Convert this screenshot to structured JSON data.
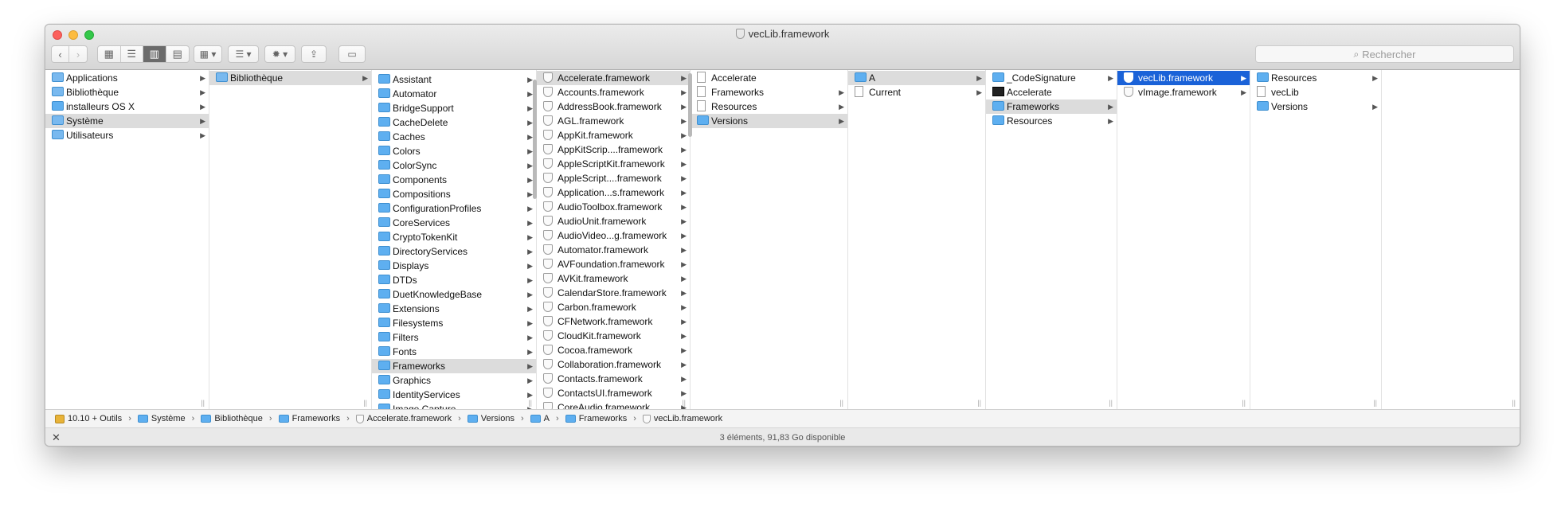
{
  "window": {
    "title": "vecLib.framework"
  },
  "toolbar": {
    "back": "‹",
    "forward": "›",
    "view_icon": "▦",
    "view_list": "☰",
    "view_column": "▥",
    "view_cover": "▤",
    "arrange": "▦ ▾",
    "sort": "☰ ▾",
    "action": "✹ ▾",
    "share": "⇪",
    "tags": "▭"
  },
  "search": {
    "placeholder": "Rechercher",
    "icon": "search-icon"
  },
  "columns": [
    {
      "items": [
        {
          "label": "Applications",
          "icon": "folder-gen",
          "arrow": true
        },
        {
          "label": "Bibliothèque",
          "icon": "folder-gen",
          "arrow": true
        },
        {
          "label": "installeurs OS X",
          "icon": "folder",
          "arrow": true
        },
        {
          "label": "Système",
          "icon": "folder-gen",
          "arrow": true,
          "state": "sel"
        },
        {
          "label": "Utilisateurs",
          "icon": "folder-gen",
          "arrow": true
        }
      ]
    },
    {
      "items": [
        {
          "label": "Bibliothèque",
          "icon": "folder-gen",
          "arrow": true,
          "state": "sel"
        }
      ]
    },
    {
      "items": [
        {
          "label": "Assistant",
          "icon": "folder",
          "arrow": true
        },
        {
          "label": "Automator",
          "icon": "folder",
          "arrow": true
        },
        {
          "label": "BridgeSupport",
          "icon": "folder",
          "arrow": true
        },
        {
          "label": "CacheDelete",
          "icon": "folder",
          "arrow": true
        },
        {
          "label": "Caches",
          "icon": "folder",
          "arrow": true
        },
        {
          "label": "Colors",
          "icon": "folder",
          "arrow": true
        },
        {
          "label": "ColorSync",
          "icon": "folder",
          "arrow": true
        },
        {
          "label": "Components",
          "icon": "folder",
          "arrow": true
        },
        {
          "label": "Compositions",
          "icon": "folder",
          "arrow": true
        },
        {
          "label": "ConfigurationProfiles",
          "icon": "folder",
          "arrow": true
        },
        {
          "label": "CoreServices",
          "icon": "folder",
          "arrow": true
        },
        {
          "label": "CryptoTokenKit",
          "icon": "folder",
          "arrow": true
        },
        {
          "label": "DirectoryServices",
          "icon": "folder",
          "arrow": true
        },
        {
          "label": "Displays",
          "icon": "folder",
          "arrow": true
        },
        {
          "label": "DTDs",
          "icon": "folder",
          "arrow": true
        },
        {
          "label": "DuetKnowledgeBase",
          "icon": "folder",
          "arrow": true
        },
        {
          "label": "Extensions",
          "icon": "folder",
          "arrow": true
        },
        {
          "label": "Filesystems",
          "icon": "folder",
          "arrow": true
        },
        {
          "label": "Filters",
          "icon": "folder",
          "arrow": true
        },
        {
          "label": "Fonts",
          "icon": "folder",
          "arrow": true
        },
        {
          "label": "Frameworks",
          "icon": "folder",
          "arrow": true,
          "state": "sel"
        },
        {
          "label": "Graphics",
          "icon": "folder",
          "arrow": true
        },
        {
          "label": "IdentityServices",
          "icon": "folder",
          "arrow": true
        },
        {
          "label": "Image Capture",
          "icon": "folder",
          "arrow": true
        }
      ]
    },
    {
      "items": [
        {
          "label": "Accelerate.framework",
          "icon": "shield",
          "arrow": true,
          "state": "sel"
        },
        {
          "label": "Accounts.framework",
          "icon": "shield",
          "arrow": true
        },
        {
          "label": "AddressBook.framework",
          "icon": "shield",
          "arrow": true
        },
        {
          "label": "AGL.framework",
          "icon": "shield",
          "arrow": true
        },
        {
          "label": "AppKit.framework",
          "icon": "shield",
          "arrow": true
        },
        {
          "label": "AppKitScrip....framework",
          "icon": "shield",
          "arrow": true
        },
        {
          "label": "AppleScriptKit.framework",
          "icon": "shield",
          "arrow": true
        },
        {
          "label": "AppleScript....framework",
          "icon": "shield",
          "arrow": true
        },
        {
          "label": "Application...s.framework",
          "icon": "shield",
          "arrow": true
        },
        {
          "label": "AudioToolbox.framework",
          "icon": "shield",
          "arrow": true
        },
        {
          "label": "AudioUnit.framework",
          "icon": "shield",
          "arrow": true
        },
        {
          "label": "AudioVideo...g.framework",
          "icon": "shield",
          "arrow": true
        },
        {
          "label": "Automator.framework",
          "icon": "shield",
          "arrow": true
        },
        {
          "label": "AVFoundation.framework",
          "icon": "shield",
          "arrow": true
        },
        {
          "label": "AVKit.framework",
          "icon": "shield",
          "arrow": true
        },
        {
          "label": "CalendarStore.framework",
          "icon": "shield",
          "arrow": true
        },
        {
          "label": "Carbon.framework",
          "icon": "shield",
          "arrow": true
        },
        {
          "label": "CFNetwork.framework",
          "icon": "shield",
          "arrow": true
        },
        {
          "label": "CloudKit.framework",
          "icon": "shield",
          "arrow": true
        },
        {
          "label": "Cocoa.framework",
          "icon": "shield",
          "arrow": true
        },
        {
          "label": "Collaboration.framework",
          "icon": "shield",
          "arrow": true
        },
        {
          "label": "Contacts.framework",
          "icon": "shield",
          "arrow": true
        },
        {
          "label": "ContactsUI.framework",
          "icon": "shield",
          "arrow": true
        },
        {
          "label": "CoreAudio.framework",
          "icon": "shield",
          "arrow": true
        }
      ]
    },
    {
      "items": [
        {
          "label": "Accelerate",
          "icon": "doc",
          "arrow": false
        },
        {
          "label": "Frameworks",
          "icon": "doc",
          "arrow": true
        },
        {
          "label": "Resources",
          "icon": "doc",
          "arrow": true
        },
        {
          "label": "Versions",
          "icon": "folder",
          "arrow": true,
          "state": "sel"
        }
      ]
    },
    {
      "items": [
        {
          "label": "A",
          "icon": "folder",
          "arrow": true,
          "state": "sel"
        },
        {
          "label": "Current",
          "icon": "doc",
          "arrow": true
        }
      ]
    },
    {
      "items": [
        {
          "label": "_CodeSignature",
          "icon": "folder",
          "arrow": true
        },
        {
          "label": "Accelerate",
          "icon": "exe",
          "arrow": false
        },
        {
          "label": "Frameworks",
          "icon": "folder",
          "arrow": true,
          "state": "sel"
        },
        {
          "label": "Resources",
          "icon": "folder",
          "arrow": true
        }
      ]
    },
    {
      "items": [
        {
          "label": "vecLib.framework",
          "icon": "shield",
          "arrow": true,
          "state": "act"
        },
        {
          "label": "vImage.framework",
          "icon": "shield",
          "arrow": true
        }
      ]
    },
    {
      "items": [
        {
          "label": "Resources",
          "icon": "folder",
          "arrow": true
        },
        {
          "label": "vecLib",
          "icon": "doc",
          "arrow": false
        },
        {
          "label": "Versions",
          "icon": "folder",
          "arrow": true
        }
      ]
    },
    {
      "items": []
    }
  ],
  "pathbar": [
    {
      "label": "10.10 + Outils",
      "icon": "disk"
    },
    {
      "label": "Système",
      "icon": "folder"
    },
    {
      "label": "Bibliothèque",
      "icon": "folder"
    },
    {
      "label": "Frameworks",
      "icon": "folder"
    },
    {
      "label": "Accelerate.framework",
      "icon": "shield"
    },
    {
      "label": "Versions",
      "icon": "folder"
    },
    {
      "label": "A",
      "icon": "folder"
    },
    {
      "label": "Frameworks",
      "icon": "folder"
    },
    {
      "label": "vecLib.framework",
      "icon": "shield"
    }
  ],
  "status": {
    "text": "3 éléments, 91,83 Go disponible",
    "close": "✕"
  }
}
